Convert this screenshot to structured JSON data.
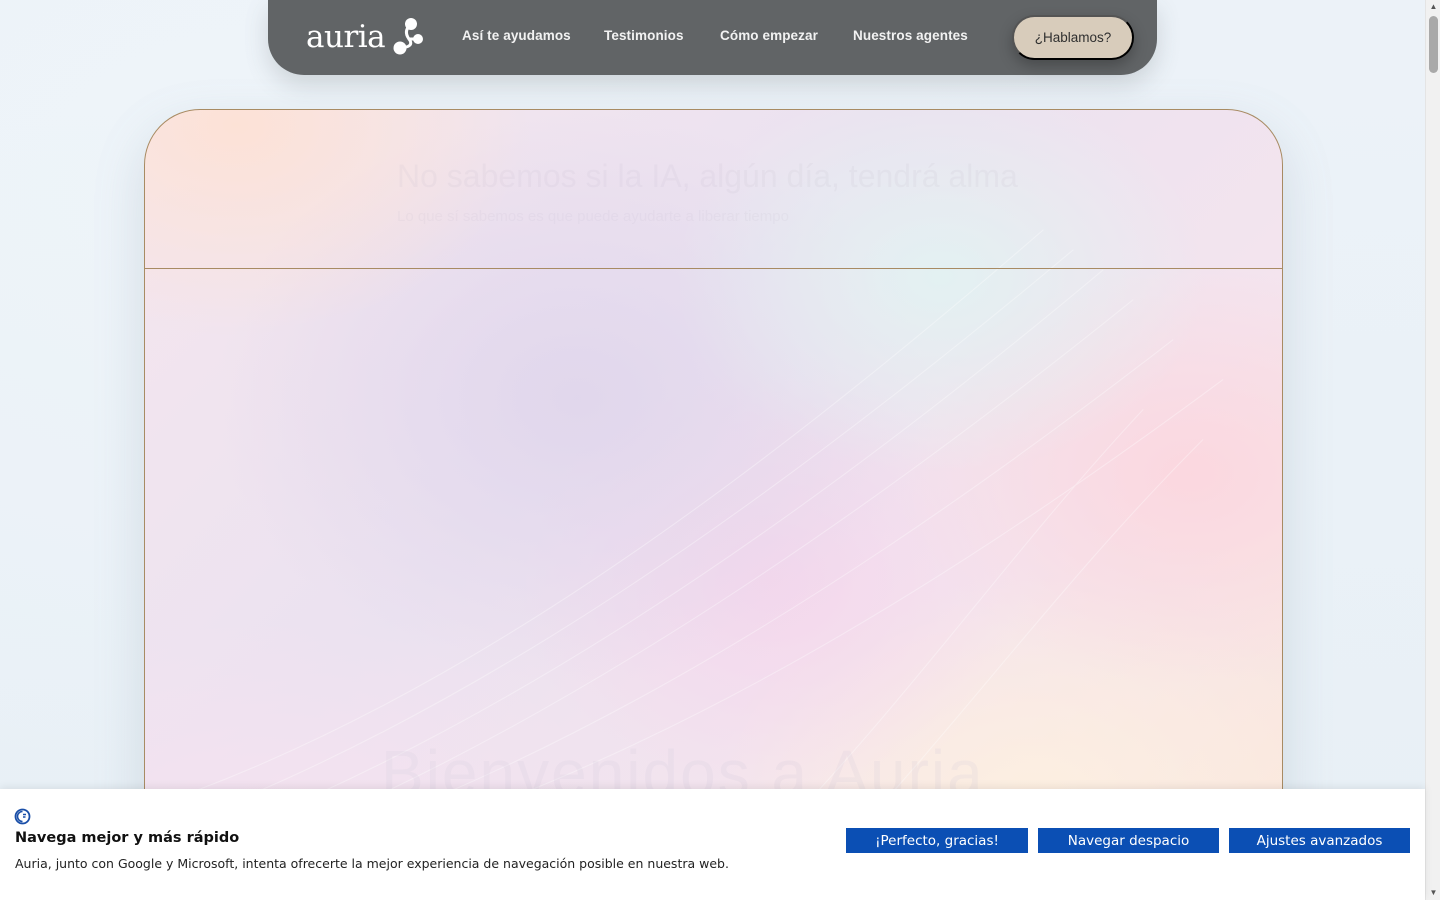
{
  "header": {
    "logo_text": "auria",
    "nav_items": [
      {
        "label": "Así te ayudamos"
      },
      {
        "label": "Testimonios"
      },
      {
        "label": "Cómo empezar"
      },
      {
        "label": "Nuestros agentes"
      }
    ],
    "cta_label": "¿Hablamos?"
  },
  "hero": {
    "faded_title": "No sabemos si la IA, algún día, tendrá alma",
    "faded_subtitle": "Lo que sí sabemos es que puede ayudarte a liberar tiempo",
    "faded_heading": "Bienvenidos a Auria"
  },
  "cookie_banner": {
    "title": "Navega mejor y más rápido",
    "text": "Auria, junto con Google y Microsoft, intenta ofrecerte la mejor experiencia de navegación posible en nuestra web.",
    "buttons": [
      {
        "label": "¡Perfecto, gracias!"
      },
      {
        "label": "Navegar despacio"
      },
      {
        "label": "Ajustes avanzados"
      }
    ]
  },
  "colors": {
    "nav_bg": "#616466",
    "cta_bg": "#d8ccbb",
    "hero_border": "#a88b63",
    "cookie_button": "#0b4fb4"
  },
  "icons": {
    "logo_mark": "molecule-dots-icon",
    "cookie": "cookie-consent-icon"
  }
}
